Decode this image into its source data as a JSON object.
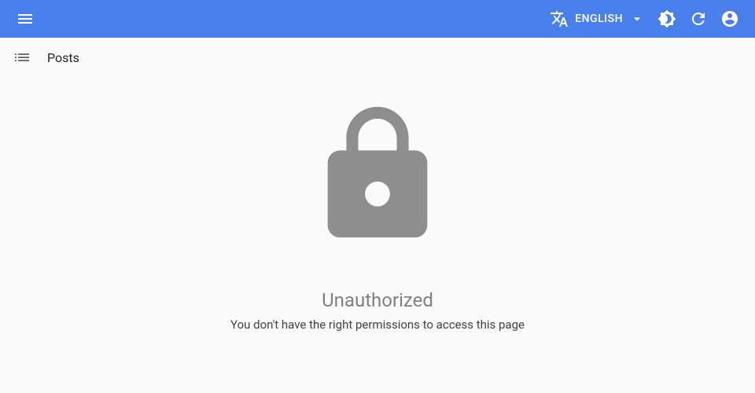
{
  "header": {
    "language_label": "ENGLISH"
  },
  "breadcrumb": {
    "title": "Posts"
  },
  "error": {
    "title": "Unauthorized",
    "message": "You don't have the right permissions to access this page"
  }
}
